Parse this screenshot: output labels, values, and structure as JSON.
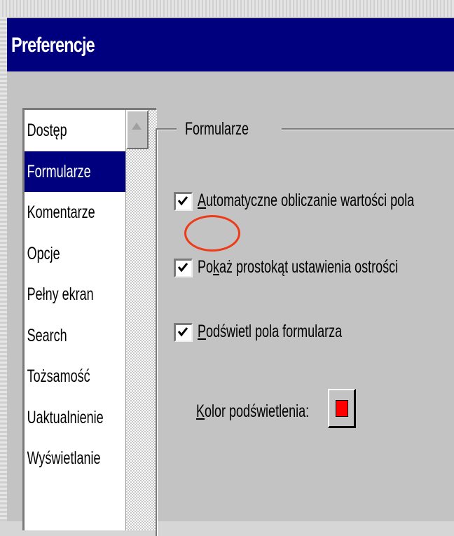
{
  "window": {
    "title": "Preferencje"
  },
  "sidebar": {
    "items": [
      {
        "label": "Dostęp",
        "selected": false
      },
      {
        "label": "Formularze",
        "selected": true
      },
      {
        "label": "Komentarze",
        "selected": false
      },
      {
        "label": "Opcje",
        "selected": false
      },
      {
        "label": "Pełny ekran",
        "selected": false
      },
      {
        "label": "Search",
        "selected": false
      },
      {
        "label": "Tożsamość",
        "selected": false
      },
      {
        "label": "Uaktualnienie",
        "selected": false
      },
      {
        "label": "Wyświetlanie",
        "selected": false
      }
    ]
  },
  "forms": {
    "group_label": "Formularze",
    "auto_calc": {
      "access": "A",
      "rest": "utomatyczne obliczanie wartości pola",
      "checked": true
    },
    "focus_rect": {
      "access": "k",
      "before": "Po",
      "after": "aż prostokąt ustawienia ostrości",
      "checked": true
    },
    "highlight": {
      "access": "P",
      "rest": "odświetl pola formularza",
      "checked": true
    },
    "color": {
      "access": "K",
      "rest": "olor podświetlenia:",
      "value": "#ff0000"
    }
  },
  "colors": {
    "titlebar": "#00007e",
    "selection": "#00007e",
    "annotation": "#ee3a16"
  }
}
